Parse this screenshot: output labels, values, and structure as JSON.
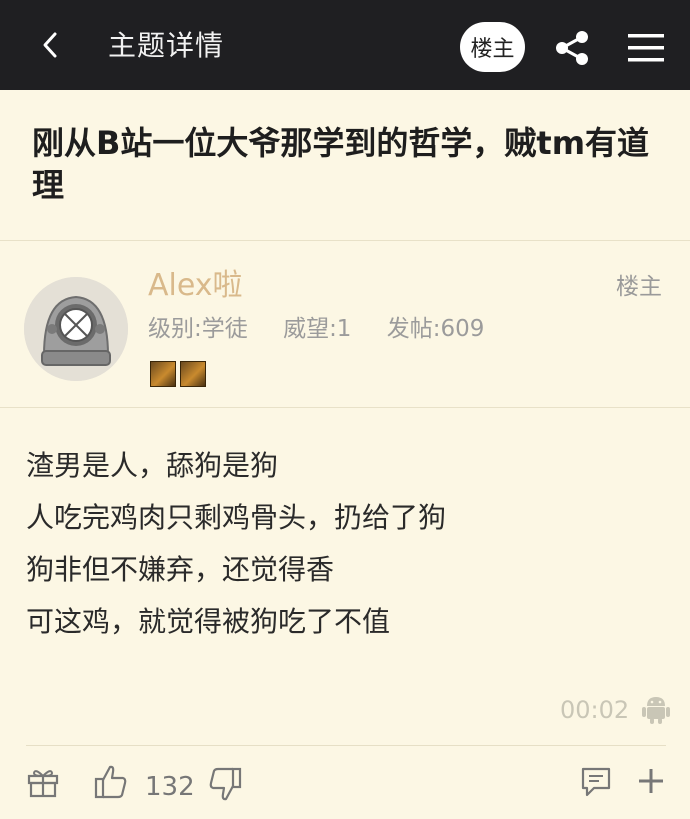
{
  "header": {
    "title": "主题详情",
    "op_button_label": "楼主",
    "icons": {
      "back": "chevron-left-icon",
      "share": "share-icon",
      "menu": "hamburger-menu-icon"
    }
  },
  "post": {
    "title": "刚从B站一位大爷那学到的哲学，贼tm有道理"
  },
  "author": {
    "name": "Alex啦",
    "op_tag": "楼主",
    "level": "级别:学徒",
    "reputation": "威望:1",
    "posts": "发帖:609",
    "avatar_icon": "diving-helmet-avatar-icon",
    "badge_icons": [
      "medal-badge-icon",
      "medal-badge-icon"
    ]
  },
  "content": {
    "lines": [
      "渣男是人，舔狗是狗",
      "人吃完鸡肉只剩鸡骨头，扔给了狗",
      "狗非但不嫌弃，还觉得香",
      "可这鸡，就觉得被狗吃了不值"
    ],
    "timestamp": "00:02",
    "device_icon": "android-icon"
  },
  "actions": {
    "like_count": "132",
    "icons": {
      "gift": "gift-icon",
      "like": "thumbs-up-icon",
      "dislike": "thumbs-down-icon",
      "comment": "comment-icon",
      "add": "plus-icon"
    }
  },
  "colors": {
    "topbar_bg": "#1f1f22",
    "page_bg": "#fcf7e4",
    "author_name": "#d9b98b",
    "meta_text": "#9b9b9b"
  }
}
